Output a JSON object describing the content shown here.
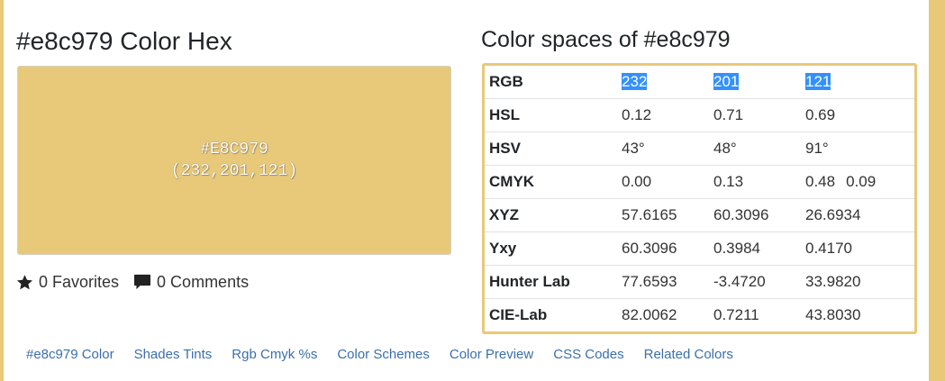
{
  "page": {
    "title": "#e8c979 Color Hex",
    "accent_color": "#e8c979"
  },
  "swatch": {
    "color": "#e8c979",
    "hex_label": "#E8C979",
    "rgb_label": "(232,201,121)"
  },
  "meta": {
    "favorites": {
      "icon": "star-icon",
      "label": "0 Favorites"
    },
    "comments": {
      "icon": "comment-icon",
      "label": "0 Comments"
    }
  },
  "color_spaces": {
    "title": "Color spaces of #e8c979",
    "rows": [
      {
        "name": "RGB",
        "values": [
          "232",
          "201",
          "121"
        ],
        "extra": "",
        "selected": true
      },
      {
        "name": "HSL",
        "values": [
          "0.12",
          "0.71",
          "0.69"
        ],
        "extra": ""
      },
      {
        "name": "HSV",
        "values": [
          "43°",
          "48°",
          "91°"
        ],
        "extra": ""
      },
      {
        "name": "CMYK",
        "values": [
          "0.00",
          "0.13",
          "0.48"
        ],
        "extra": "0.09"
      },
      {
        "name": "XYZ",
        "values": [
          "57.6165",
          "60.3096",
          "26.6934"
        ],
        "extra": ""
      },
      {
        "name": "Yxy",
        "values": [
          "60.3096",
          "0.3984",
          "0.4170"
        ],
        "extra": ""
      },
      {
        "name": "Hunter Lab",
        "values": [
          "77.6593",
          "-3.4720",
          "33.9820"
        ],
        "extra": ""
      },
      {
        "name": "CIE-Lab",
        "values": [
          "82.0062",
          "0.7211",
          "43.8030"
        ],
        "extra": ""
      }
    ]
  },
  "nav": {
    "links": [
      "#e8c979 Color",
      "Shades Tints",
      "Rgb Cmyk %s",
      "Color Schemes",
      "Color Preview",
      "CSS Codes",
      "Related Colors"
    ]
  }
}
